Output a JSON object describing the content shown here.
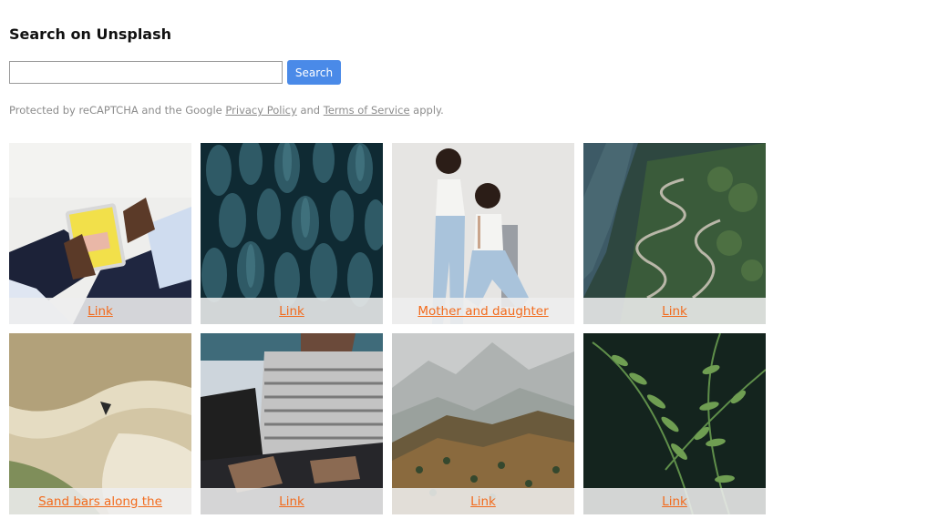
{
  "header": {
    "title": "Search on Unsplash"
  },
  "search": {
    "placeholder": "",
    "value": "",
    "button_label": "Search"
  },
  "recaptcha": {
    "prefix": "Protected by reCAPTCHA and the Google",
    "privacy_label": "Privacy Policy",
    "and": "and",
    "terms_label": "Terms of Service",
    "suffix": "apply."
  },
  "colors": {
    "accent": "#4a8ae8",
    "link": "#f26b1d",
    "muted": "#8c8c8c"
  },
  "gallery": {
    "tiles": [
      {
        "subject": "tablet-in-hands",
        "caption": "Link"
      },
      {
        "subject": "cactus-field",
        "caption": "Link"
      },
      {
        "subject": "mother-and-daughter",
        "caption": "Mother and daughter"
      },
      {
        "subject": "coastal-serpentine-road",
        "caption": "Link"
      },
      {
        "subject": "sand-bars",
        "caption": "Sand bars along the"
      },
      {
        "subject": "person-on-laptop",
        "caption": "Link"
      },
      {
        "subject": "foggy-mountains",
        "caption": "Link"
      },
      {
        "subject": "fern-leaves",
        "caption": "Link"
      }
    ]
  }
}
